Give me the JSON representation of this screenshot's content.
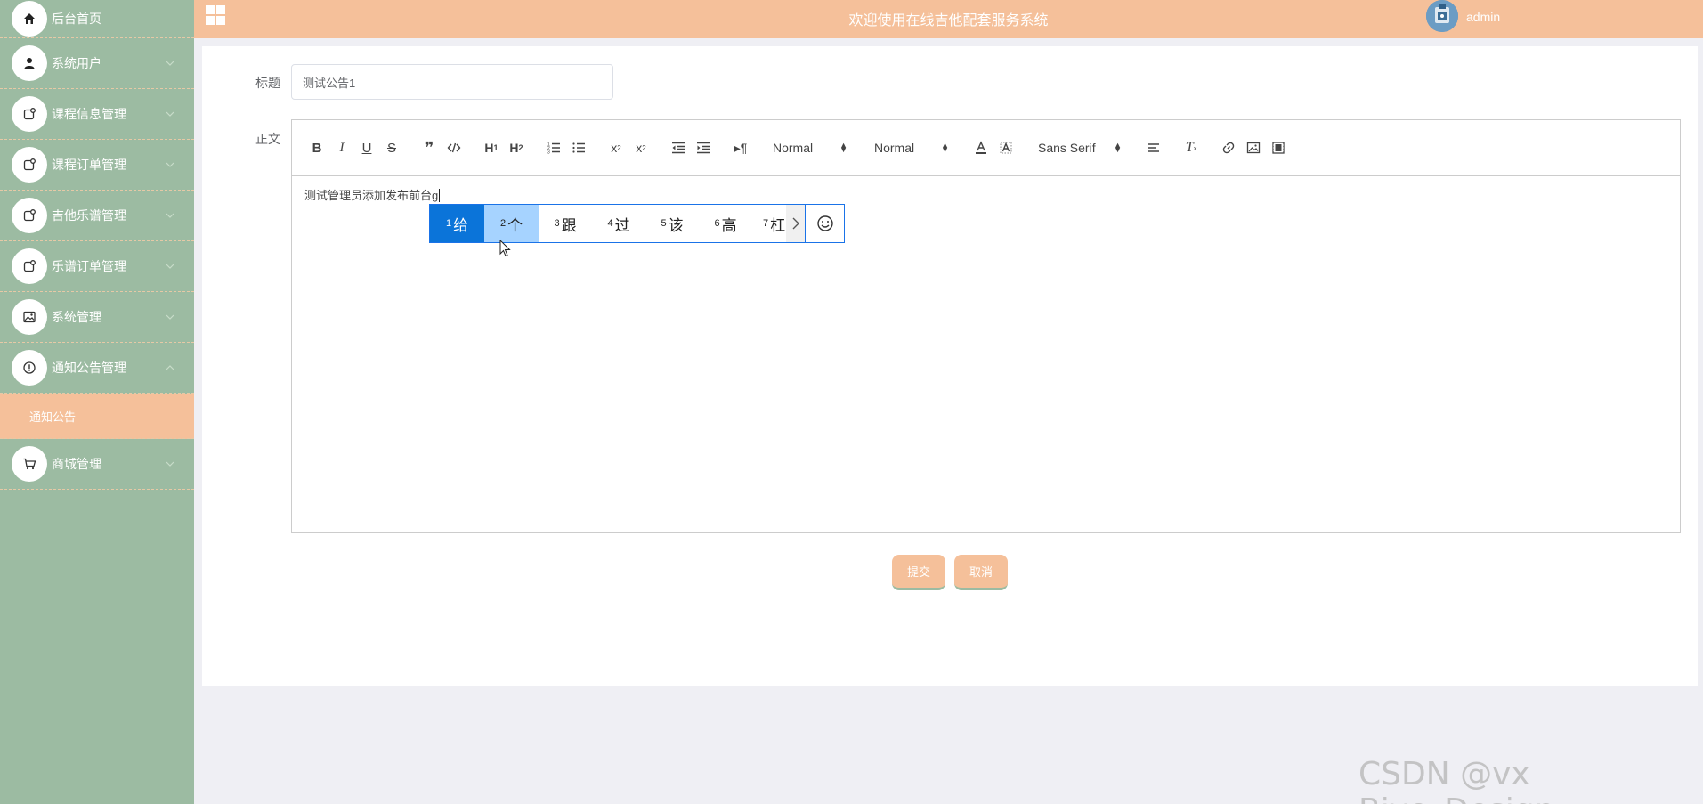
{
  "sidebar": {
    "items": [
      {
        "label": "后台首页",
        "icon": "home-icon"
      },
      {
        "label": "系统用户",
        "icon": "user-icon"
      },
      {
        "label": "课程信息管理",
        "icon": "app-icon"
      },
      {
        "label": "课程订单管理",
        "icon": "app-icon"
      },
      {
        "label": "吉他乐谱管理",
        "icon": "app-icon"
      },
      {
        "label": "乐谱订单管理",
        "icon": "app-icon"
      },
      {
        "label": "系统管理",
        "icon": "picture-icon"
      },
      {
        "label": "通知公告管理",
        "icon": "info-icon"
      },
      {
        "label": "商城管理",
        "icon": "cart-icon"
      }
    ],
    "active_subitem": "通知公告"
  },
  "header": {
    "title": "欢迎使用在线吉他配套服务系统",
    "username": "admin"
  },
  "form": {
    "title_label": "标题",
    "title_value": "测试公告1",
    "body_label": "正文",
    "body_text": "测试管理员添加发布前台g",
    "toolbar": {
      "header_picker": "Normal",
      "size_picker": "Normal",
      "font_picker": "Sans Serif"
    },
    "submit_label": "提交",
    "cancel_label": "取消"
  },
  "ime": {
    "candidates": [
      {
        "n": "1",
        "c": "给"
      },
      {
        "n": "2",
        "c": "个"
      },
      {
        "n": "3",
        "c": "跟"
      },
      {
        "n": "4",
        "c": "过"
      },
      {
        "n": "5",
        "c": "该"
      },
      {
        "n": "6",
        "c": "高"
      },
      {
        "n": "7",
        "c": "杠"
      }
    ]
  },
  "watermark": "CSDN @vx Biye_Design",
  "colors": {
    "sidebar": "#9cbba2",
    "accent": "#f5c09a",
    "ime_selected": "#0b74d9"
  }
}
